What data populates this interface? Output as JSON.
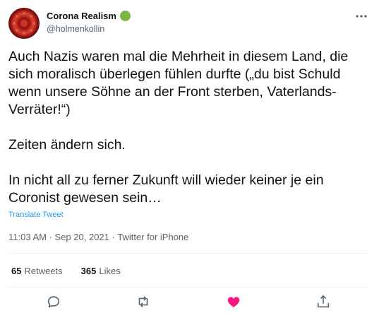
{
  "author": {
    "display_name": "Corona Realism",
    "handle": "@holmenkollin",
    "badge_color": "#7cb342"
  },
  "tweet": {
    "text": "Auch Nazis waren mal die Mehrheit in diesem Land, die sich moralisch überlegen fühlen durfte („du bist Schuld wenn unsere Söhne an der Front sterben, Vaterlands-Verräter!“)\n\nZeiten ändern sich.\n\nIn nicht all zu ferner Zukunft will wieder keiner je ein Coronist gewesen sein…",
    "translate_label": "Translate Tweet",
    "time": "11:03 AM",
    "separator": " · ",
    "date": "Sep 20, 2021",
    "source": "Twitter for iPhone"
  },
  "stats": {
    "retweets_count": "65",
    "retweets_label": "Retweets",
    "likes_count": "365",
    "likes_label": "Likes"
  },
  "icons": {
    "more": "more-horizontal-icon",
    "reply": "reply-icon",
    "retweet": "retweet-icon",
    "like": "heart-icon",
    "share": "share-icon"
  },
  "colors": {
    "link": "#1d9bf0",
    "like_active": "#f91880",
    "muted": "#536471"
  }
}
